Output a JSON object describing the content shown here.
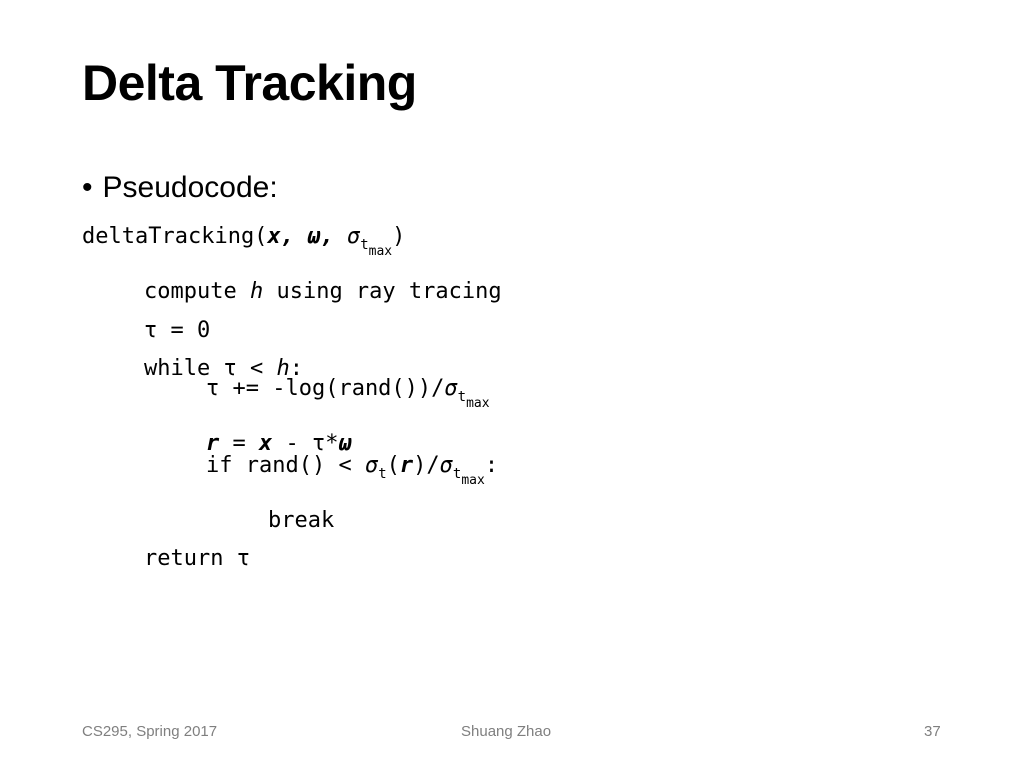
{
  "slide": {
    "title": "Delta Tracking",
    "bullet_marker": "•",
    "bullet_text": "Pseudocode:"
  },
  "code": {
    "signature": {
      "name": "deltaTracking(",
      "arg_x": "x",
      "sep1": ", ",
      "arg_omega": "ω",
      "sep2": ", ",
      "sigma": "σ",
      "sub_t": "t",
      "sub_max": "max",
      "close": ")"
    },
    "line1": {
      "pre": "compute ",
      "var": "h",
      "post": " using ray tracing"
    },
    "line2": {
      "text": "τ = 0"
    },
    "line3": {
      "pre": "while τ < ",
      "var": "h",
      "post": ":"
    },
    "line4": {
      "pre": "τ += -log(rand())/",
      "sigma": "σ",
      "sub_t": "t",
      "sub_max": "max"
    },
    "line5": {
      "r": "r",
      "eq": " = ",
      "x": "x",
      "minus": " - τ*",
      "omega": "ω"
    },
    "line6": {
      "pre": "if rand() < ",
      "sigma1": "σ",
      "sub_t1": "t",
      "open": "(",
      "r": "r",
      "close": ")/",
      "sigma2": "σ",
      "sub_t2": "t",
      "sub_max": "max",
      "colon": ":"
    },
    "line7": {
      "text": "break"
    },
    "line8": {
      "text": "return τ"
    }
  },
  "footer": {
    "course": "CS295, Spring 2017",
    "author": "Shuang Zhao",
    "page_number": "37"
  }
}
